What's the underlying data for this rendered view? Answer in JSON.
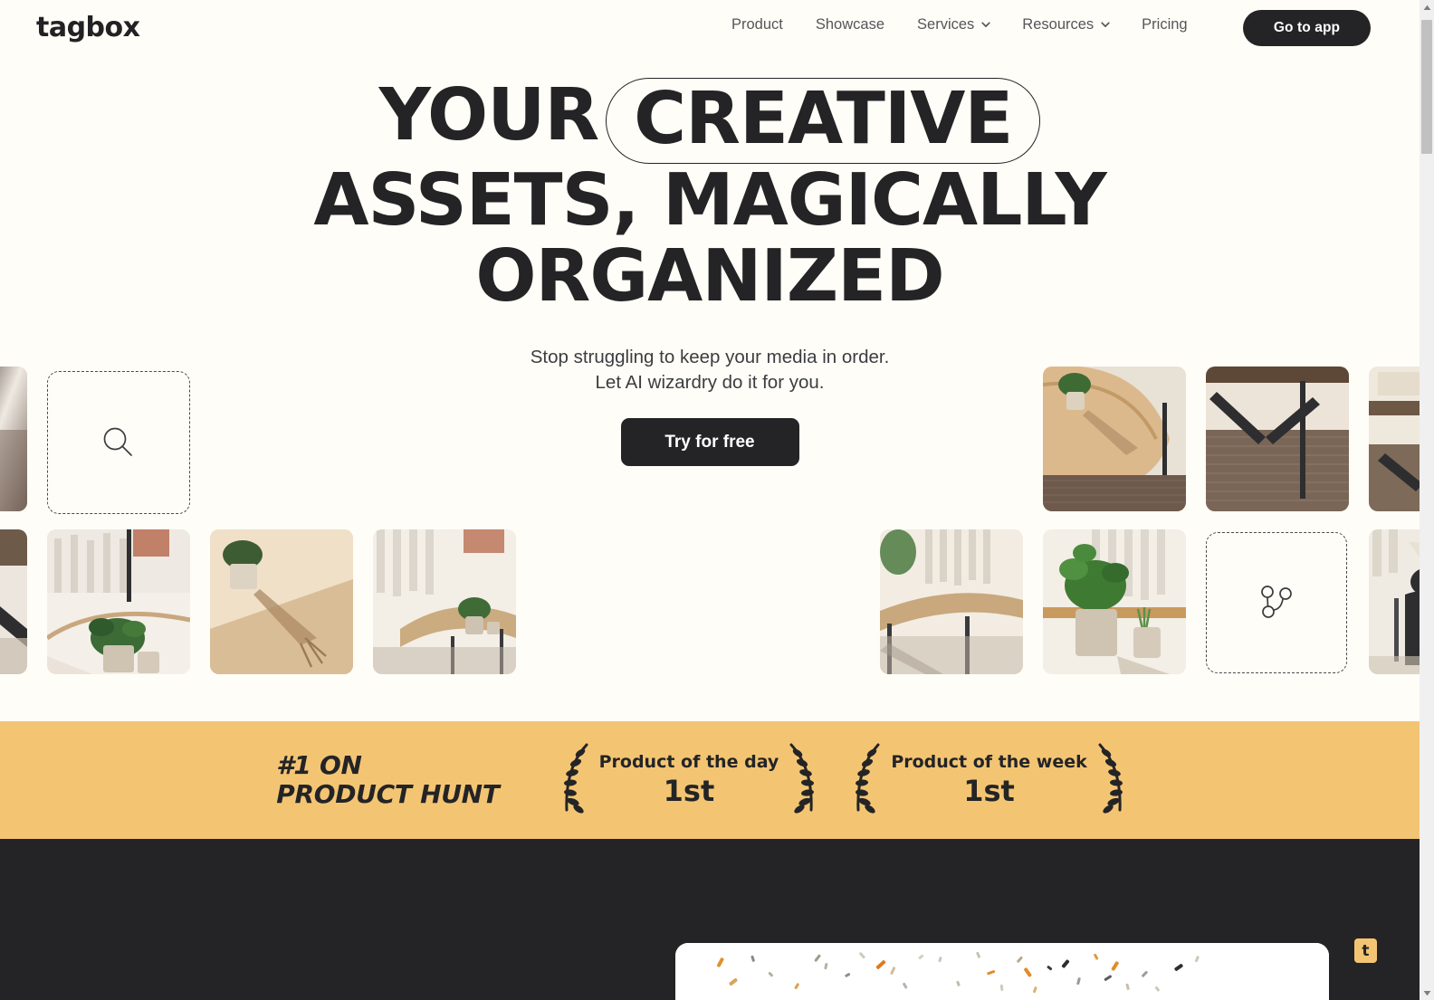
{
  "brand": {
    "logo_text": "tagbox"
  },
  "nav": {
    "items": [
      {
        "label": "Product",
        "has_dropdown": false
      },
      {
        "label": "Showcase",
        "has_dropdown": false
      },
      {
        "label": "Services",
        "has_dropdown": true
      },
      {
        "label": "Resources",
        "has_dropdown": true
      },
      {
        "label": "Pricing",
        "has_dropdown": false
      }
    ],
    "cta_label": "Go to app"
  },
  "hero": {
    "headline_line1_a": "YOUR",
    "headline_line1_pill": "CREATIVE",
    "headline_line2": "ASSETS, MAGICALLY",
    "headline_line3": "ORGANIZED",
    "subtitle_line1": "Stop struggling to keep your media in order.",
    "subtitle_line2": "Let AI wizardry do it for you.",
    "cta_label": "Try for free"
  },
  "gallery": {
    "placeholder_search_icon": "search-icon",
    "placeholder_branch_icon": "git-branch-icon"
  },
  "product_hunt": {
    "title_line1": "#1 ON",
    "title_line2": "PRODUCT HUNT",
    "badges": [
      {
        "label": "Product of the day",
        "rank": "1st"
      },
      {
        "label": "Product of the week",
        "rank": "1st"
      }
    ],
    "background_color": "#f3c573"
  },
  "footer_section": {
    "background_color": "#242426",
    "floating_badge_label": "t",
    "floating_badge_color": "#f3c573"
  },
  "scrollbar": {
    "up_arrow_icon": "triangle-up-icon",
    "down_arrow_icon": "triangle-down-icon"
  },
  "colors": {
    "page_background": "#fffdf7",
    "ink": "#242426",
    "accent": "#f3c573"
  }
}
